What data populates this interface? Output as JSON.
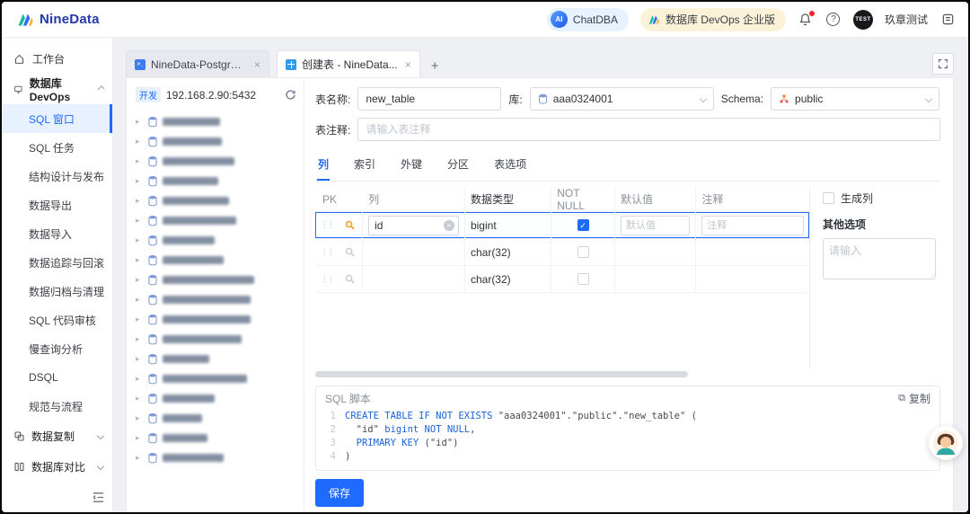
{
  "header": {
    "brand": "NineData",
    "chatdba_label": "ChatDBA",
    "edition_label": "数据库 DevOps 企业版",
    "avatar_badge": "TEST",
    "tenant_name": "玖章测试"
  },
  "sidebar": {
    "workbench": "工作台",
    "devops_group": "数据库 DevOps",
    "devops_items": [
      {
        "key": "sql-window",
        "label": "SQL 窗口",
        "active": true
      },
      {
        "key": "sql-task",
        "label": "SQL 任务"
      },
      {
        "key": "schema-design-release",
        "label": "结构设计与发布"
      },
      {
        "key": "data-export",
        "label": "数据导出"
      },
      {
        "key": "data-import",
        "label": "数据导入"
      },
      {
        "key": "data-track-rollback",
        "label": "数据追踪与回滚"
      },
      {
        "key": "data-archive-clean",
        "label": "数据归档与清理"
      },
      {
        "key": "sql-code-review",
        "label": "SQL 代码审核"
      },
      {
        "key": "slow-query-analysis",
        "label": "慢查询分析"
      },
      {
        "key": "dsql",
        "label": "DSQL"
      },
      {
        "key": "standard-process",
        "label": "规范与流程"
      }
    ],
    "groups": [
      {
        "key": "data-replication",
        "label": "数据复制"
      },
      {
        "key": "database-compare",
        "label": "数据库对比"
      }
    ]
  },
  "tabs": {
    "items": [
      {
        "key": "sql-console",
        "label": "NineData-PostgreS...",
        "icon": "console",
        "active": false
      },
      {
        "key": "create-table",
        "label": "创建表 - NineData...",
        "icon": "table",
        "active": true
      }
    ],
    "new_tab": "+"
  },
  "tree": {
    "env_tag": "开发",
    "connection": "192.168.2.90:5432",
    "redacted_item_widths": [
      64,
      66,
      80,
      62,
      74,
      82,
      58,
      68,
      102,
      98,
      98,
      88,
      52,
      94,
      58,
      44,
      50,
      68
    ]
  },
  "form": {
    "table_name_label": "表名称:",
    "table_name_value": "new_table",
    "db_label": "库:",
    "db_value": "aaa0324001",
    "schema_label": "Schema:",
    "schema_value": "public",
    "comment_label": "表注释:",
    "comment_placeholder": "请输入表注释"
  },
  "editor_tabs": [
    {
      "key": "columns",
      "label": "列",
      "active": true
    },
    {
      "key": "indexes",
      "label": "索引"
    },
    {
      "key": "foreign-keys",
      "label": "外键"
    },
    {
      "key": "partitions",
      "label": "分区"
    },
    {
      "key": "table-options",
      "label": "表选项"
    }
  ],
  "columns_grid": {
    "headers": {
      "pk": "PK",
      "name": "列",
      "type": "数据类型",
      "not_null": "NOT NULL",
      "default": "默认值",
      "comment": "注释"
    },
    "rows": [
      {
        "name": "id",
        "type": "bigint",
        "pk": true,
        "not_null": true,
        "selected": true,
        "default_placeholder": "默认值",
        "comment_placeholder": "注释"
      },
      {
        "name": "",
        "type": "char(32)",
        "pk": false,
        "not_null": false,
        "selected": false
      },
      {
        "name": "",
        "type": "char(32)",
        "pk": false,
        "not_null": false,
        "selected": false
      }
    ],
    "generated_label": "生成列",
    "other_label": "其他选项",
    "other_placeholder": "请输入"
  },
  "sql_panel": {
    "title": "SQL 脚本",
    "copy_label": "复制",
    "lines": [
      [
        {
          "t": "CREATE TABLE IF NOT EXISTS ",
          "c": "kw"
        },
        {
          "t": "\"aaa0324001\".\"public\".\"new_table\"",
          "c": "str"
        },
        {
          "t": " (",
          "c": "pl"
        }
      ],
      [
        {
          "t": "  ",
          "c": "pl"
        },
        {
          "t": "\"id\"",
          "c": "str"
        },
        {
          "t": " ",
          "c": "pl"
        },
        {
          "t": "bigint",
          "c": "type"
        },
        {
          "t": " ",
          "c": "pl"
        },
        {
          "t": "NOT NULL",
          "c": "kw"
        },
        {
          "t": ",",
          "c": "pl"
        }
      ],
      [
        {
          "t": "  ",
          "c": "pl"
        },
        {
          "t": "PRIMARY KEY",
          "c": "kw"
        },
        {
          "t": " (",
          "c": "pl"
        },
        {
          "t": "\"id\"",
          "c": "str"
        },
        {
          "t": ")",
          "c": "pl"
        }
      ],
      [
        {
          "t": ")",
          "c": "pl"
        }
      ]
    ]
  },
  "save_label": "保存"
}
